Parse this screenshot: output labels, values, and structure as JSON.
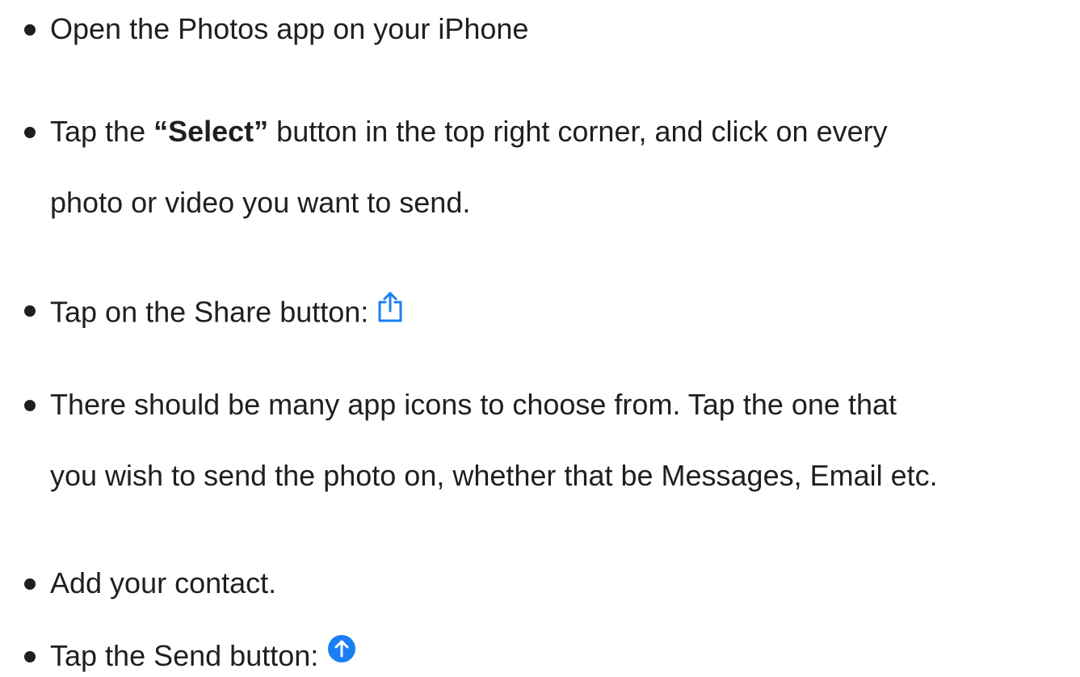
{
  "steps": [
    {
      "line1": "Open the Photos app on your iPhone"
    },
    {
      "line1_prefix": "Tap the ",
      "line1_bold": "“Select”",
      "line1_suffix": " button in the top right corner, and click on every",
      "line2": "photo or video you want to send."
    },
    {
      "line1": "Tap on the Share button:",
      "icon": "share-icon"
    },
    {
      "line1": "There should be many app icons to choose from. Tap the one that",
      "line2": "you wish to send the photo on, whether that be Messages, Email etc."
    },
    {
      "line1": "Add your contact."
    },
    {
      "line1": "Tap the Send button:",
      "icon": "send-icon"
    }
  ],
  "colors": {
    "text": "#1f1f1f",
    "accent": "#1a7ff5"
  }
}
